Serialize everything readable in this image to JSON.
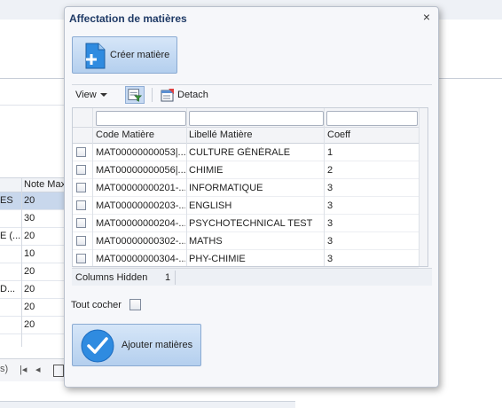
{
  "background_grid": {
    "column_header": "Note Max",
    "rows": [
      {
        "c1": "ES",
        "c2": "20",
        "selected": true
      },
      {
        "c1": "",
        "c2": "30"
      },
      {
        "c1": "E (...",
        "c2": "20"
      },
      {
        "c1": "",
        "c2": "10"
      },
      {
        "c1": "",
        "c2": "20"
      },
      {
        "c1": "D...",
        "c2": "20"
      },
      {
        "c1": "",
        "c2": "20"
      },
      {
        "c1": "",
        "c2": "20"
      }
    ],
    "pager_text": "s)"
  },
  "dialog": {
    "title": "Affectation de matières",
    "close_glyph": "×",
    "create_button_label": "Créer matière",
    "toolbar": {
      "view_label": "View",
      "detach_label": "Detach"
    },
    "grid": {
      "columns": {
        "code": "Code Matière",
        "libelle": "Libellé Matière",
        "coeff": "Coeff"
      },
      "rows": [
        {
          "code": "MAT00000000053|...",
          "libelle": "CULTURE GÉNÉRALE",
          "coeff": "1"
        },
        {
          "code": "MAT00000000056|...",
          "libelle": "CHIMIE",
          "coeff": "2"
        },
        {
          "code": "MAT00000000201-...",
          "libelle": "INFORMATIQUE",
          "coeff": "3"
        },
        {
          "code": "MAT00000000203-...",
          "libelle": "ENGLISH",
          "coeff": "3"
        },
        {
          "code": "MAT00000000204-...",
          "libelle": "PSYCHOTECHNICAL TEST",
          "coeff": "3"
        },
        {
          "code": "MAT00000000302-...",
          "libelle": "MATHS",
          "coeff": "3"
        },
        {
          "code": "MAT00000000304-...",
          "libelle": "PHY-CHIMIE",
          "coeff": "3"
        }
      ]
    },
    "footer": {
      "columns_hidden_label": "Columns Hidden",
      "columns_hidden_count": "1"
    },
    "tout_cocher_label": "Tout cocher",
    "add_button_label": "Ajouter matières",
    "colors": {
      "title": "#1f3a66",
      "button_top": "#d6e6f8",
      "button_bottom": "#b4cfee",
      "icon_blue": "#2f8be0"
    }
  }
}
